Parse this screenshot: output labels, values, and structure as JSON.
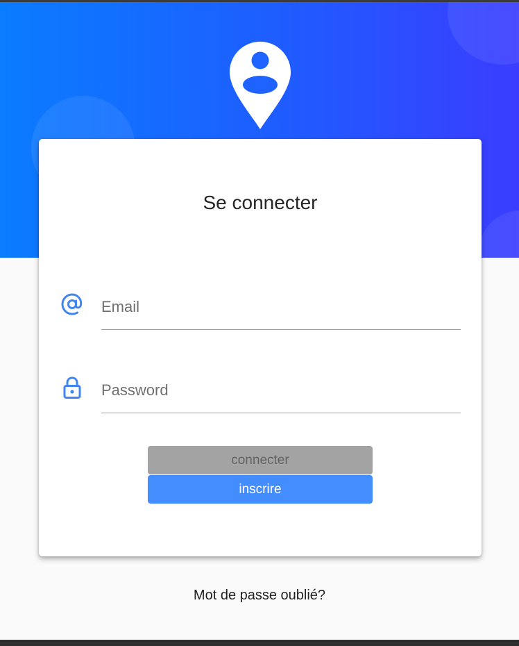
{
  "header": {
    "logo_icon": "user-location-pin-icon",
    "gradient": [
      "#0a7cff",
      "#3a3dff"
    ]
  },
  "login_card": {
    "title": "Se connecter",
    "email_field": {
      "icon": "at-sign-icon",
      "placeholder": "Email",
      "value": ""
    },
    "password_field": {
      "icon": "lock-icon",
      "placeholder": "Password",
      "value": ""
    },
    "connect_button": {
      "label": "connecter",
      "state": "disabled",
      "color": "#a3a3a3"
    },
    "signup_button": {
      "label": "inscrire",
      "color": "#448dff"
    }
  },
  "forgot_password_link": "Mot de passe oublié?",
  "colors": {
    "accent": "#448dff",
    "icon": "#3f86f0",
    "background": "#fafafa"
  }
}
